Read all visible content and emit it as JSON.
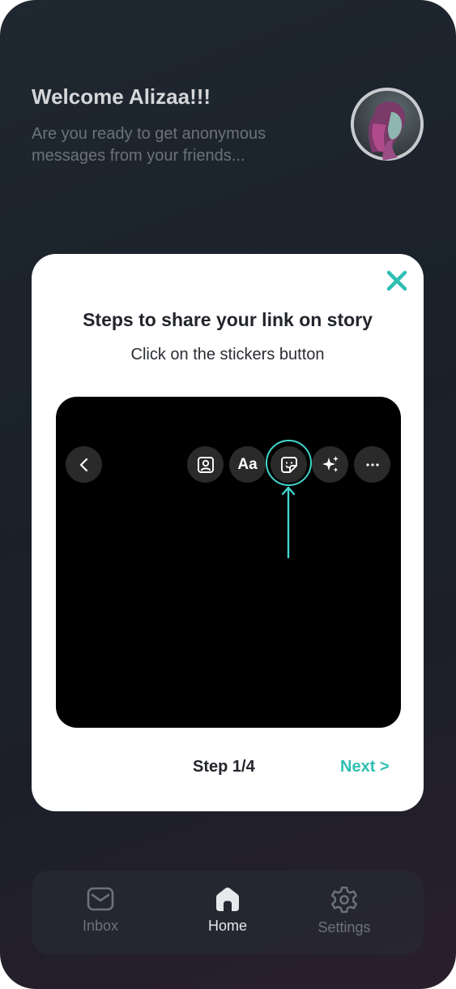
{
  "header": {
    "title": "Welcome Alizaa!!!",
    "subtitle": "Are you ready to get anonymous messages from your friends..."
  },
  "modal": {
    "title": "Steps to share your link on story",
    "instruction": "Click on the stickers button",
    "text_tool_label": "Aa",
    "step_label": "Step 1/4",
    "next_label": "Next >"
  },
  "nav": {
    "items": [
      {
        "label": "Inbox",
        "icon": "mail-icon",
        "active": false
      },
      {
        "label": "Home",
        "icon": "home-icon",
        "active": true
      },
      {
        "label": "Settings",
        "icon": "gear-icon",
        "active": false
      }
    ]
  },
  "colors": {
    "accent": "#2fbfb3",
    "highlight_ring": "#41d6cc",
    "modal_bg": "#ffffff",
    "preview_bg": "#000000",
    "nav_inactive": "#6b727b",
    "nav_active": "#e6e8eb"
  }
}
